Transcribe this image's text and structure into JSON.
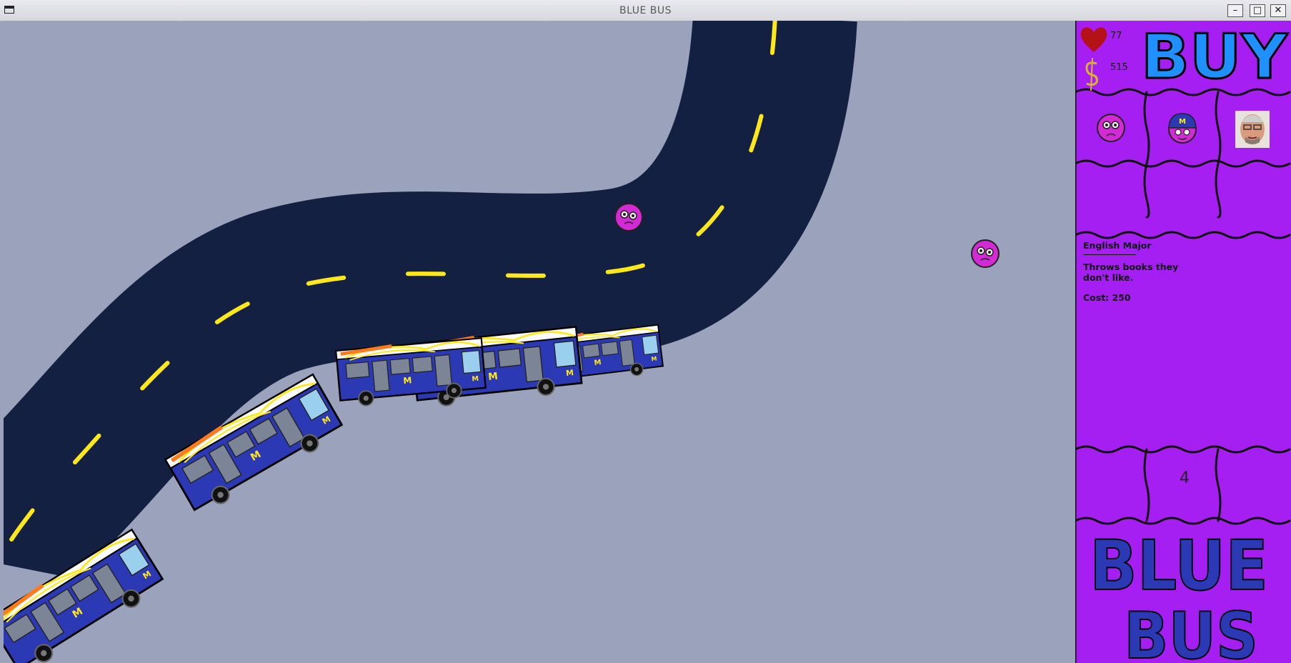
{
  "window": {
    "title": "BLUE BUS"
  },
  "hud": {
    "health": "77",
    "money": "515"
  },
  "shop": {
    "title": "BUY",
    "towers": [
      {
        "icon": "english-major-face"
      },
      {
        "icon": "blue-cap-student-face"
      },
      {
        "icon": "professor-portrait"
      }
    ]
  },
  "selected": {
    "name": "English Major",
    "description": "Throws books they don't like.",
    "cost": "Cost: 250"
  },
  "wave": "4",
  "logo": {
    "line1": "BLUE",
    "line2": "BUS"
  },
  "colors": {
    "panel": "#a51ff2",
    "road": "#142042",
    "grass": "#9ba3bc",
    "lane_paint": "#ffe81a",
    "bus_body": "#2c39b5",
    "enemy": "#d42ad6"
  }
}
